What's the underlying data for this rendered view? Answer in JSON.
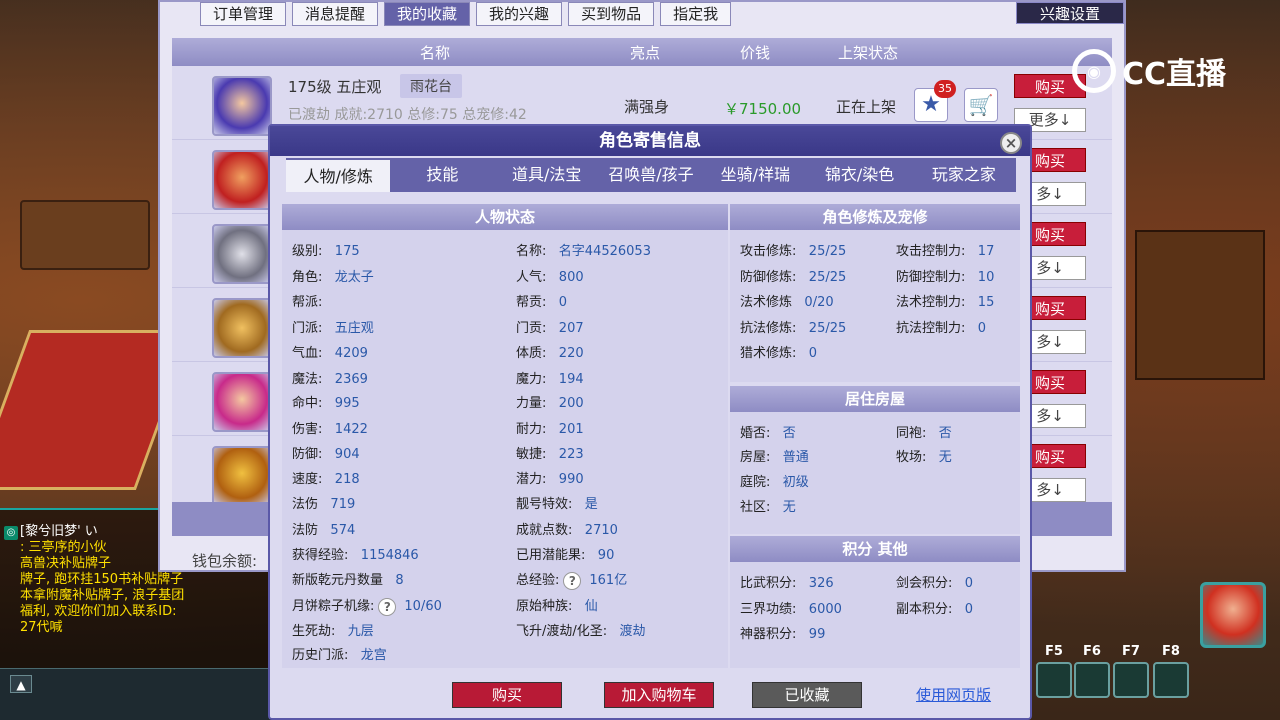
{
  "back": {
    "tabs": [
      "订单管理",
      "消息提醒",
      "我的收藏",
      "我的兴趣",
      "买到物品",
      "指定我"
    ],
    "interest_settings": "兴趣设置",
    "columns": [
      "名称",
      "亮点",
      "价钱",
      "上架状态"
    ],
    "row1": {
      "title": "175级 五庄观",
      "school": "雨花台",
      "sub": "已渡劫 成就:2710 总修:75 总宠修:42",
      "highlight": "满强身",
      "price": "￥7150.00",
      "status": "正在上架",
      "star_count": "35"
    },
    "buy": "购买",
    "more": "更多↓",
    "buy_partial": "购买",
    "more_partial": "多↓",
    "wallet": "钱包余额:"
  },
  "watermark": "CC直播",
  "chat": {
    "name": "[黎兮旧梦' い",
    "lines": [
      ": 三亭序的小伙",
      "高兽决补贴牌子",
      "牌子, 跑环挂150书补贴牌子",
      "本拿附魔补贴牌子, 浪子基团",
      "福利, 欢迎你们加入联系ID:",
      "27代喊"
    ]
  },
  "hotkeys": [
    "F5",
    "F6",
    "F7",
    "F8"
  ],
  "modal": {
    "title": "角色寄售信息",
    "tabs": [
      "人物/修炼",
      "技能",
      "道具/法宝",
      "召唤兽/孩子",
      "坐骑/祥瑞",
      "锦衣/染色",
      "玩家之家"
    ],
    "status_title": "人物状态",
    "cultivation_title": "角色修炼及宠修",
    "house_title": "居住房屋",
    "score_title": "积分 其他",
    "left_col": [
      [
        "级别:",
        "175"
      ],
      [
        "角色:",
        "龙太子"
      ],
      [
        "帮派:",
        ""
      ],
      [
        "门派:",
        "五庄观"
      ],
      [
        "气血:",
        "4209"
      ],
      [
        "魔法:",
        "2369"
      ],
      [
        "命中:",
        "995"
      ],
      [
        "伤害:",
        "1422"
      ],
      [
        "防御:",
        "904"
      ],
      [
        "速度:",
        "218"
      ],
      [
        "法伤",
        "719"
      ],
      [
        "法防",
        "574"
      ],
      [
        "获得经验:",
        "1154846"
      ],
      [
        "新版乾元丹数量",
        "8"
      ],
      [
        "月饼粽子机缘:",
        "10/60"
      ],
      [
        "生死劫:",
        "九层"
      ],
      [
        "历史门派:",
        "龙宫"
      ]
    ],
    "mid_col": [
      [
        "名称:",
        "名字44526053"
      ],
      [
        "人气:",
        "800"
      ],
      [
        "帮贡:",
        "0"
      ],
      [
        "门贡:",
        "207"
      ],
      [
        "体质:",
        "220"
      ],
      [
        "魔力:",
        "194"
      ],
      [
        "力量:",
        "200"
      ],
      [
        "耐力:",
        "201"
      ],
      [
        "敏捷:",
        "223"
      ],
      [
        "潜力:",
        "990"
      ],
      [
        "靓号特效:",
        "是"
      ],
      [
        "成就点数:",
        "2710"
      ],
      [
        "已用潜能果:",
        "90"
      ],
      [
        "总经验:",
        "161亿"
      ],
      [
        "原始种族:",
        "仙"
      ],
      [
        "飞升/渡劫/化圣:",
        "渡劫"
      ]
    ],
    "cult": [
      [
        "攻击修炼:",
        "25/25",
        "攻击控制力:",
        "17"
      ],
      [
        "防御修炼:",
        "25/25",
        "防御控制力:",
        "10"
      ],
      [
        "法术修炼",
        "0/20",
        "法术控制力:",
        "15"
      ],
      [
        "抗法修炼:",
        "25/25",
        "抗法控制力:",
        "0"
      ],
      [
        "猎术修炼:",
        "0",
        "",
        ""
      ]
    ],
    "house": [
      [
        "婚否:",
        "否",
        "同袍:",
        "否"
      ],
      [
        "房屋:",
        "普通",
        "牧场:",
        "无"
      ],
      [
        "庭院:",
        "初级",
        "",
        ""
      ],
      [
        "社区:",
        "无",
        "",
        ""
      ]
    ],
    "score": [
      [
        "比武积分:",
        "326",
        "剑会积分:",
        "0"
      ],
      [
        "三界功绩:",
        "6000",
        "副本积分:",
        "0"
      ],
      [
        "神器积分:",
        "99",
        "",
        ""
      ]
    ],
    "btn_buy": "购买",
    "btn_cart": "加入购物车",
    "btn_fav": "已收藏",
    "web_link": "使用网页版"
  }
}
